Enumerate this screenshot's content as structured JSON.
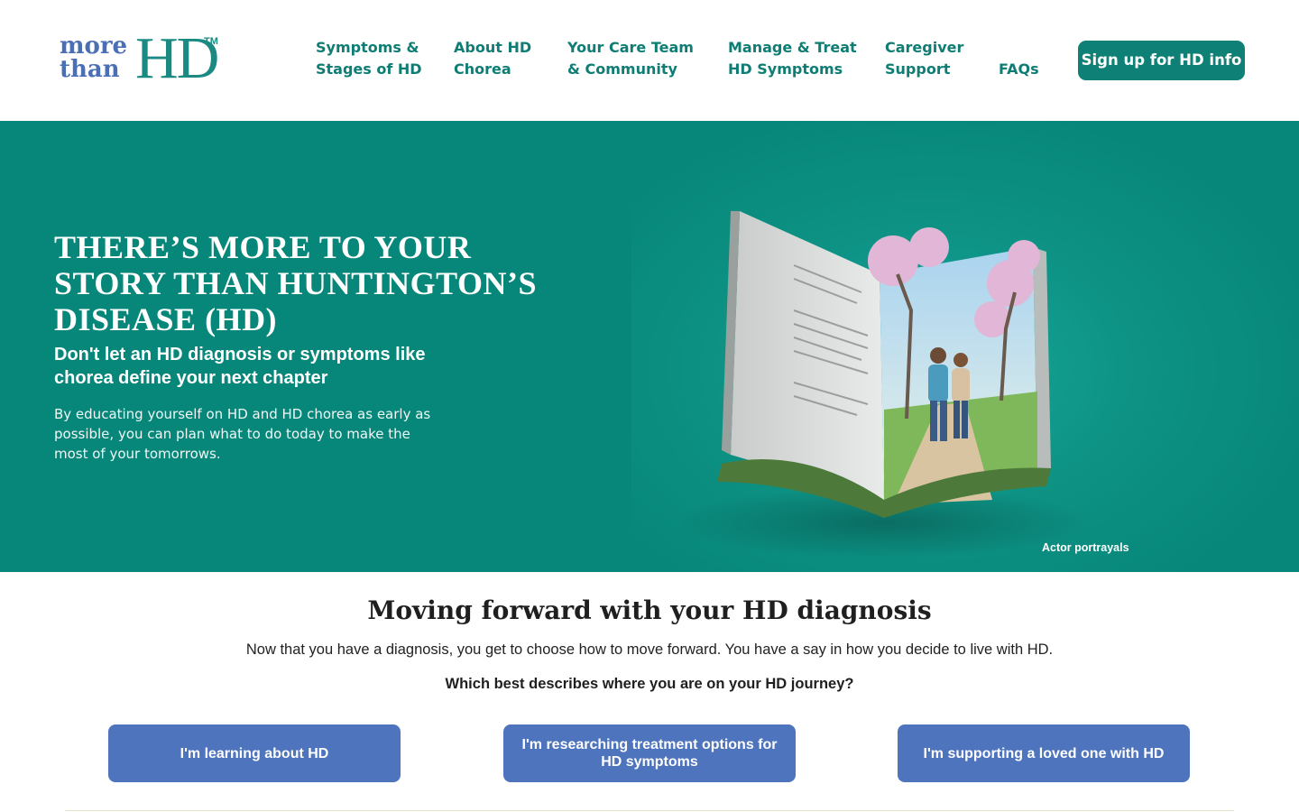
{
  "brand": {
    "logo_line1": "more",
    "logo_line2": "than",
    "logo_mark": "HD",
    "logo_tm": "TM",
    "colors": {
      "teal": "#0f8075",
      "blue": "#4e74be",
      "hero_bg": "#078779"
    }
  },
  "nav": {
    "items": [
      {
        "label": "Symptoms &\nStages of HD"
      },
      {
        "label": "About HD\nChorea"
      },
      {
        "label": "Your Care Team\n& Community"
      },
      {
        "label": "Manage & Treat\nHD Symptoms"
      },
      {
        "label": "Caregiver\nSupport"
      },
      {
        "label": "FAQs"
      }
    ],
    "cta": "Sign up for HD info"
  },
  "hero": {
    "title_part1": "THERE’S ",
    "title_strong": "MORE",
    "title_part2": " TO YOUR STORY THAN HUNTINGTON’S DISEASE (HD)",
    "subtitle": "Don't let an HD diagnosis or symptoms like chorea define your next chapter",
    "body": "By educating yourself on HD and HD chorea as early as possible, you can plan what to do today to make the most of your tomorrows.",
    "image_caption": "Actor portrayals",
    "image_alt_icon": "open-book-garden-illustration"
  },
  "journey": {
    "title": "Moving forward with your HD diagnosis",
    "intro": "Now that you have a diagnosis, you get to choose how to move forward. You have a say in how you decide to live with HD.",
    "question": "Which best describes where you are on your HD journey?",
    "options": [
      {
        "label": "I'm learning about HD"
      },
      {
        "label": "I'm researching treatment options for HD symptoms"
      },
      {
        "label": "I'm supporting a loved one with HD"
      }
    ]
  }
}
